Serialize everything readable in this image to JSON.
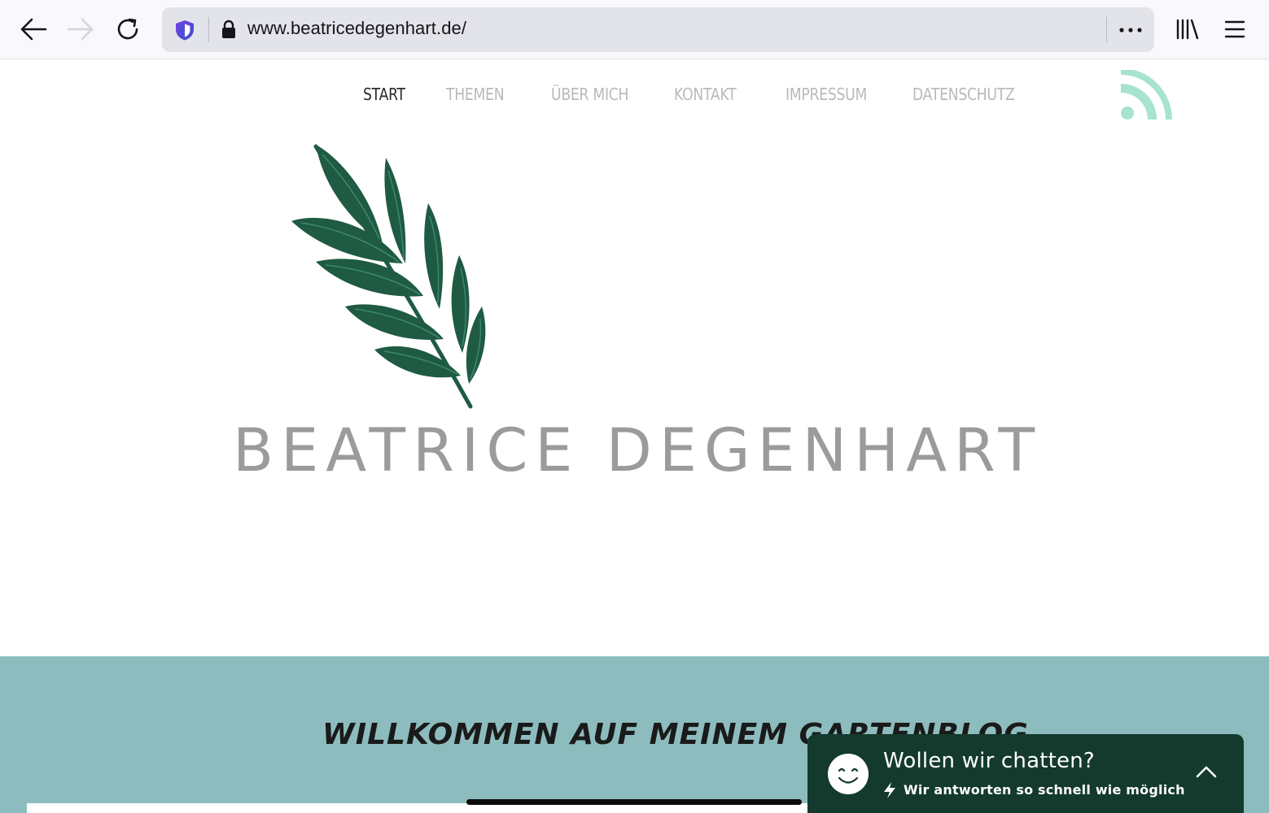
{
  "browser": {
    "url": "www.beatricedegenhart.de/",
    "icons": {
      "back": "back-arrow-icon",
      "forward": "forward-arrow-icon",
      "reload": "reload-icon",
      "shield": "tracking-protection-shield-icon",
      "lock": "lock-icon",
      "more": "more-dots-icon",
      "library": "library-icon",
      "menu": "hamburger-menu-icon"
    }
  },
  "nav": {
    "items": [
      {
        "label": "START",
        "active": true
      },
      {
        "label": "THEMEN",
        "active": false
      },
      {
        "label": "ÜBER MICH",
        "active": false
      },
      {
        "label": "KONTAKT",
        "active": false
      },
      {
        "label": "IMPRESSUM",
        "active": false
      },
      {
        "label": "DATENSCHUTZ",
        "active": false
      }
    ],
    "rss_icon": "rss-feed-icon"
  },
  "header": {
    "logo_icon": "leaf-branch-logo-icon",
    "brand_name": "BEATRICE DEGENHART"
  },
  "welcome": {
    "heading": "WILLKOMMEN AUF MEINEM GARTENBLOG"
  },
  "chat": {
    "title": "Wollen wir chatten?",
    "subtitle": "Wir antworten so schnell wie möglich",
    "icons": {
      "avatar": "smiley-face-icon",
      "bolt": "lightning-bolt-icon",
      "toggle": "chevron-up-icon"
    }
  },
  "colors": {
    "teal_section": "#8dbcbe",
    "leaf_green": "#1f5a43",
    "rss_mint": "#a6e3d0",
    "chat_bg": "#143a2e",
    "brand_gray": "#9b9b9b",
    "nav_inactive": "#b9b9b9",
    "nav_active": "#2b2b2b"
  }
}
